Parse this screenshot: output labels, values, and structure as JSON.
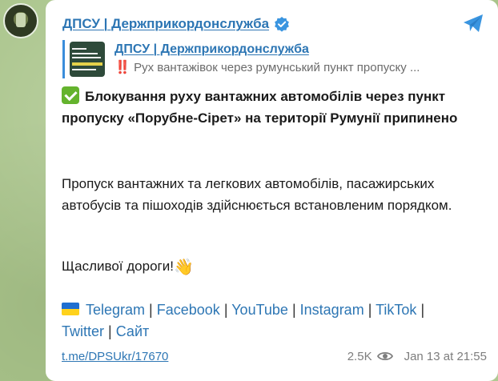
{
  "channel": {
    "name": "ДПСУ | Держприкордонслужба"
  },
  "forwarded": {
    "title": "ДПСУ | Держприкордонслужба",
    "marks": "‼️",
    "snippet": "Рух вантажівок через румунський пункт пропуску ..."
  },
  "message": {
    "headline": "Блокування руху вантажних автомобілів через пункт пропуску «Порубне-Сірет» на території Румунії припинено",
    "paragraph": "Пропуск вантажних та легкових автомобілів, пасажирських автобусів та пішоходів здійснюється встановленим порядком.",
    "closing": "Щасливої дороги!",
    "closing_emoji": "👋"
  },
  "links": [
    {
      "label": "Telegram"
    },
    {
      "label": "Facebook"
    },
    {
      "label": "YouTube"
    },
    {
      "label": "Instagram"
    },
    {
      "label": "TikTok"
    },
    {
      "label": "Twitter"
    },
    {
      "label": "Сайт"
    }
  ],
  "separator": "|",
  "footer": {
    "permalink": "t.me/DPSUkr/17670",
    "views": "2.5K",
    "timestamp": "Jan 13 at 21:55"
  },
  "icons": {
    "verified": "verified-badge-icon",
    "share": "share-icon",
    "views": "eye-icon",
    "check": "check-mark-icon",
    "flag": "ukraine-flag-icon"
  },
  "colors": {
    "link": "#2d76b4",
    "background": "#a9c48a",
    "accent_bar": "#3a8ddb",
    "check": "#64b32d"
  }
}
